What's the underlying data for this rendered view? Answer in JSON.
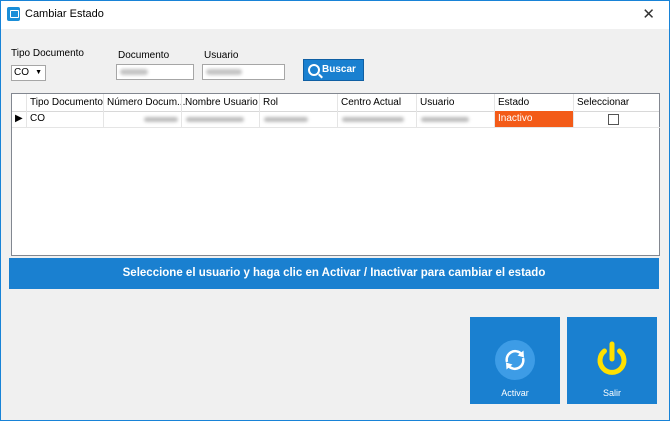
{
  "window": {
    "title": "Cambiar Estado",
    "close_icon": "close-icon"
  },
  "filters": {
    "tipo_documento_label": "Tipo Documento",
    "tipo_documento_value": "CO",
    "documento_label": "Documento",
    "usuario_label": "Usuario",
    "buscar_label": "Buscar"
  },
  "grid": {
    "columns": [
      "Tipo Documento",
      "Número Docum...",
      "Nombre Usuario",
      "Rol",
      "Centro Actual",
      "Usuario",
      "Estado",
      "Seleccionar"
    ],
    "rows": [
      {
        "tipo_documento": "CO",
        "estado": "Inactivo",
        "seleccionar": false
      }
    ]
  },
  "banner": {
    "text": "Seleccione el usuario y haga clic en Activar / Inactivar para cambiar el estado"
  },
  "buttons": {
    "activar": "Activar",
    "salir": "Salir"
  },
  "colors": {
    "accent": "#1a80d0",
    "inactive": "#f35b18",
    "power_icon": "#ffe000"
  }
}
